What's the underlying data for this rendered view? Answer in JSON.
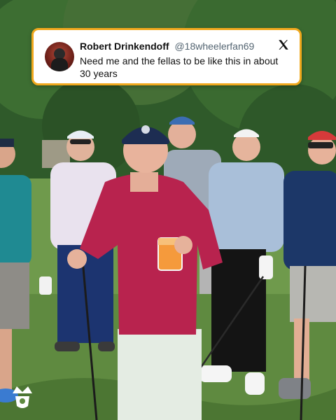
{
  "tweet": {
    "author": "Robert Drinkendoff",
    "handle": "@18wheelerfan69",
    "text": "Need me and the fellas to be like this in about 30 years"
  },
  "colors": {
    "card_border": "#f0a81d",
    "grass": "#6f9a4c",
    "trees": "#2f5a2a"
  },
  "icons": {
    "platform": "x-logo-icon",
    "brand": "barstool-crown-logo-icon"
  }
}
